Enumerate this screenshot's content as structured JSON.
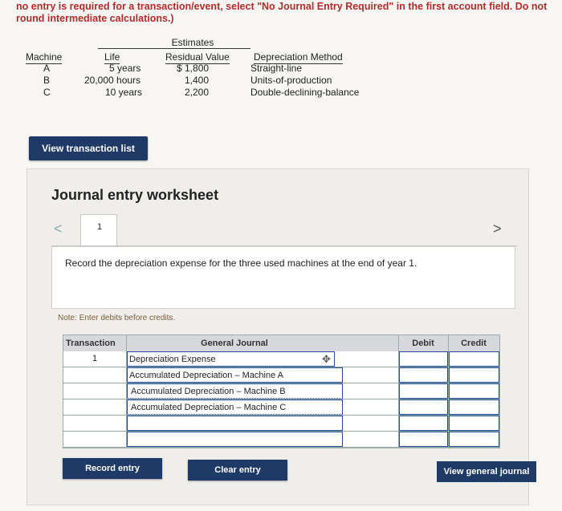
{
  "instructions": "no entry is required for a transaction/event, select \"No Journal Entry Required\" in the first account field. Do not round intermediate calculations.)",
  "estimates": {
    "group_header": "Estimates",
    "columns": [
      "Machine",
      "Life",
      "Residual Value",
      "Depreciation Method"
    ],
    "rows": [
      {
        "machine": "A",
        "life": "5 years",
        "residual": "$ 1,800",
        "method": "Straight-line"
      },
      {
        "machine": "B",
        "life": "20,000 hours",
        "residual": "1,400",
        "method": "Units-of-production"
      },
      {
        "machine": "C",
        "life": "10 years",
        "residual": "2,200",
        "method": "Double-declining-balance"
      }
    ]
  },
  "buttons": {
    "view_transaction_list": "View transaction list",
    "record_entry": "Record entry",
    "clear_entry": "Clear entry",
    "view_general_journal": "View general journal"
  },
  "worksheet": {
    "title": "Journal entry worksheet",
    "nav_prev": "<",
    "nav_next": ">",
    "tab_number": "1",
    "description": "Record the depreciation expense for the three used machines at the end of year 1.",
    "note": "Note: Enter debits before credits."
  },
  "journal": {
    "headers": {
      "transaction": "Transaction",
      "general_journal": "General Journal",
      "debit": "Debit",
      "credit": "Credit"
    },
    "rows": [
      {
        "transaction": "1",
        "account": "Depreciation Expense",
        "debit": "",
        "credit": ""
      },
      {
        "transaction": "",
        "account": "Accumulated Depreciation – Machine A",
        "debit": "",
        "credit": ""
      },
      {
        "transaction": "",
        "account": "Accumulated Depreciation – Machine B",
        "debit": "",
        "credit": ""
      },
      {
        "transaction": "",
        "account": "Accumulated Depreciation – Machine C",
        "debit": "",
        "credit": ""
      },
      {
        "transaction": "",
        "account": "",
        "debit": "",
        "credit": ""
      },
      {
        "transaction": "",
        "account": "",
        "debit": "",
        "credit": ""
      }
    ]
  },
  "colors": {
    "instruction_red": "#b32b2b",
    "button_navy": "#1f3a67",
    "input_blue": "#1f4f9a"
  },
  "icons": {
    "move": "move-icon"
  }
}
